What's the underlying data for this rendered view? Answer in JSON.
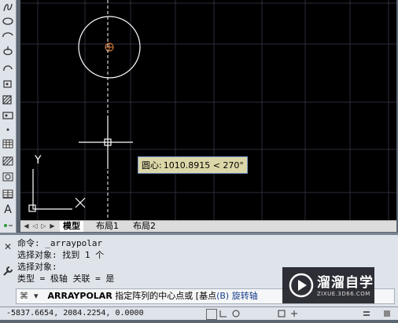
{
  "toolbar": {
    "tools": [
      "spline-icon",
      "ellipse-icon",
      "ellipse-arc-icon",
      "insert-block-icon",
      "make-block-icon",
      "point-icon",
      "hatch-icon",
      "gradient-icon",
      "region-icon",
      "table-icon",
      "text-icon",
      "add-selected-icon"
    ],
    "text_tool_label": "A"
  },
  "canvas": {
    "background": "#000000",
    "tooltip": {
      "label": "圆心:",
      "value": "1010.8915 < 270°"
    },
    "ucs": {
      "y_label": "Y"
    }
  },
  "tabs": {
    "items": [
      {
        "label": "模型",
        "active": true
      },
      {
        "label": "布局1",
        "active": false
      },
      {
        "label": "布局2",
        "active": false
      }
    ]
  },
  "command": {
    "history": [
      "命令: _arraypolar",
      "选择对象: 找到 1 个",
      "选择对象:",
      "类型 = 极轴  关联 = 是"
    ],
    "prompt": {
      "name": "ARRAYPOLAR",
      "text": "指定阵列的中心点或",
      "option_open": "[基点",
      "option_key": "(B)",
      "option_rest": "旋转轴"
    }
  },
  "status": {
    "coordinates": "-5837.6654, 2084.2254, 0.0000"
  },
  "watermark": {
    "title": "溜溜自学",
    "subtitle": "ZIXUE.3D66.COM"
  }
}
